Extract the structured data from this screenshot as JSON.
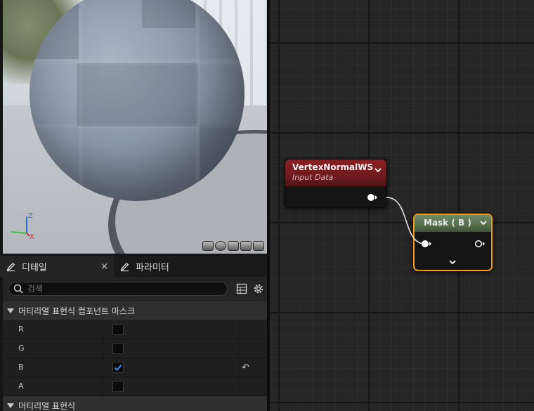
{
  "tabs": {
    "details": {
      "label": "디테일",
      "close": "×"
    },
    "parameters": {
      "label": "파라미터"
    }
  },
  "search": {
    "placeholder": "검색",
    "value": ""
  },
  "sections": {
    "mask": {
      "title": "머티리얼 표현식 컴포넌트 마스크",
      "rows": [
        {
          "label": "R",
          "checked": false
        },
        {
          "label": "G",
          "checked": false
        },
        {
          "label": "B",
          "checked": true,
          "reset_icon": "↶"
        },
        {
          "label": "A",
          "checked": false
        }
      ]
    },
    "expression": {
      "title": "머티리얼 표현식"
    }
  },
  "viewport": {
    "gizmo": {
      "z": "Z",
      "x": "X"
    },
    "view_mode_icons": [
      "cylinder-icon",
      "sphere-icon",
      "plane-icon",
      "cube-icon",
      "teapot-icon"
    ]
  },
  "graph": {
    "node_input": {
      "title": "VertexNormalWS",
      "subtitle": "Input Data"
    },
    "node_mask": {
      "title": "Mask ( B )"
    }
  },
  "colors": {
    "node_input_header": "#8c1f22",
    "node_mask_header": "#6f8a66",
    "selection_outline": "#f29a16",
    "check_mark": "#2e8cf0"
  }
}
